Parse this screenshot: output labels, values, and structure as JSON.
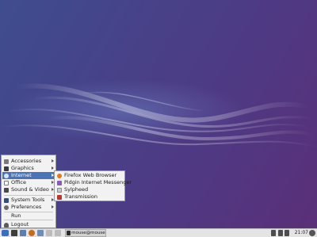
{
  "app_menu": {
    "items": [
      {
        "label": "Accessories",
        "icon": "accessories-icon",
        "submenu": true
      },
      {
        "label": "Graphics",
        "icon": "graphics-icon",
        "submenu": true
      },
      {
        "label": "Internet",
        "icon": "internet-icon",
        "submenu": true,
        "active": true
      },
      {
        "label": "Office",
        "icon": "office-icon",
        "submenu": true
      },
      {
        "label": "Sound & Video",
        "icon": "sound-video-icon",
        "submenu": true
      },
      {
        "label": "System Tools",
        "icon": "system-tools-icon",
        "submenu": true
      },
      {
        "label": "Preferences",
        "icon": "preferences-icon",
        "submenu": true
      },
      {
        "label": "Run",
        "icon": "",
        "submenu": false
      },
      {
        "label": "Logout",
        "icon": "logout-icon",
        "submenu": false
      }
    ]
  },
  "internet_submenu": {
    "items": [
      {
        "label": "Firefox Web Browser",
        "icon": "firefox-icon"
      },
      {
        "label": "Pidgin Internet Messenger",
        "icon": "pidgin-icon"
      },
      {
        "label": "Sylpheed",
        "icon": "sylpheed-icon"
      },
      {
        "label": "Transmission",
        "icon": "transmission-icon"
      }
    ]
  },
  "taskbar": {
    "task_label": "mouse@mouse-...",
    "clock": "21:07"
  },
  "colors": {
    "menu_highlight": "#4a73b8",
    "desktop_left": "#3f4d8e",
    "desktop_right": "#5a2f78",
    "taskbar": "#e4e4e4"
  }
}
